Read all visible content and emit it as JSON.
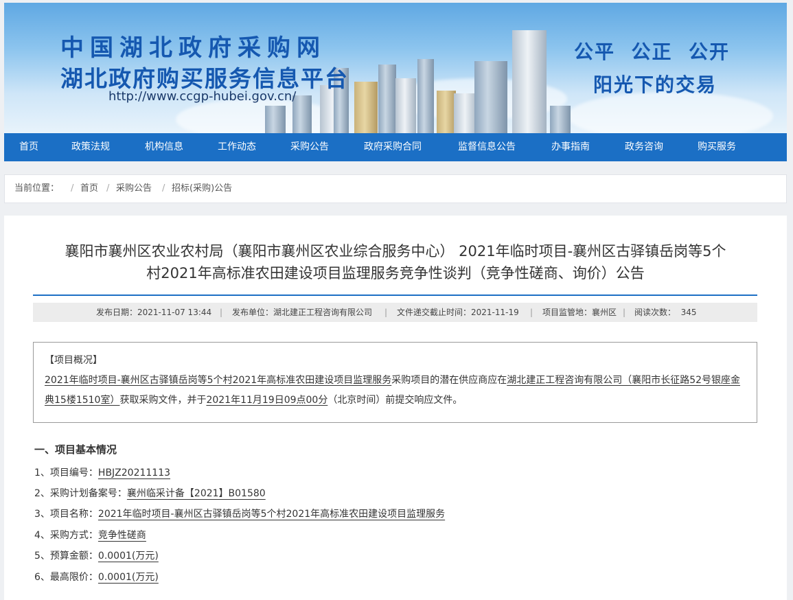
{
  "header": {
    "title_line1": "中国湖北政府采购网",
    "title_line2": "湖北政府购买服务信息平台",
    "url": "http://www.ccgp-hubei.gov.cn/",
    "slogan_line1": "公平  公正  公开",
    "slogan_line2": "阳光下的交易"
  },
  "nav": [
    "首页",
    "政策法规",
    "机构信息",
    "工作动态",
    "采购公告",
    "政府采购合同",
    "监督信息公告",
    "办事指南",
    "政务咨询",
    "购买服务"
  ],
  "breadcrumb": {
    "label": "当前位置：",
    "items": [
      "首页",
      "采购公告",
      "招标(采购)公告"
    ]
  },
  "article": {
    "title_line1": "襄阳市襄州区农业农村局（襄阳市襄州区农业综合服务中心） 2021年临时项目-襄州区古驿镇岳岗等5个",
    "title_line2": "村2021年高标准农田建设项目监理服务竞争性谈判（竞争性磋商、询价）公告",
    "meta": {
      "publish_date": "发布日期：2021-11-07 13:44",
      "publisher": "发布单位：湖北建正工程咨询有限公司",
      "deadline": "文件递交截止时间：2021-11-19",
      "supervision": "项目监管地：襄州区",
      "views": "阅读次数：  345"
    },
    "overview": {
      "heading": "【项目概况】",
      "part1": "2021年临时项目-襄州区古驿镇岳岗等5个村2021年高标准农田建设项目监理服务",
      "part2": "采购项目的潜在供应商应在",
      "part3": "湖北建正工程咨询有限公司（襄阳市长征路52号银座金典15楼1510室）",
      "part4": "获取采购文件，并于",
      "part5": "2021年11月19日09点00分",
      "part6": "（北京时间）前提交响应文件。"
    },
    "section_title": "一、项目基本情况",
    "items": [
      {
        "label": "1、项目编号：",
        "value": "HBJZ20211113"
      },
      {
        "label": "2、采购计划备案号：",
        "value": "襄州临采计备【2021】B01580"
      },
      {
        "label": "3、项目名称：",
        "value": "2021年临时项目-襄州区古驿镇岳岗等5个村2021年高标准农田建设项目监理服务"
      },
      {
        "label": "4、采购方式：",
        "value": "竞争性磋商"
      },
      {
        "label": "5、预算金额：",
        "value": "0.0001(万元)"
      },
      {
        "label": "6、最高限价：",
        "value": "0.0001(万元)"
      }
    ]
  }
}
